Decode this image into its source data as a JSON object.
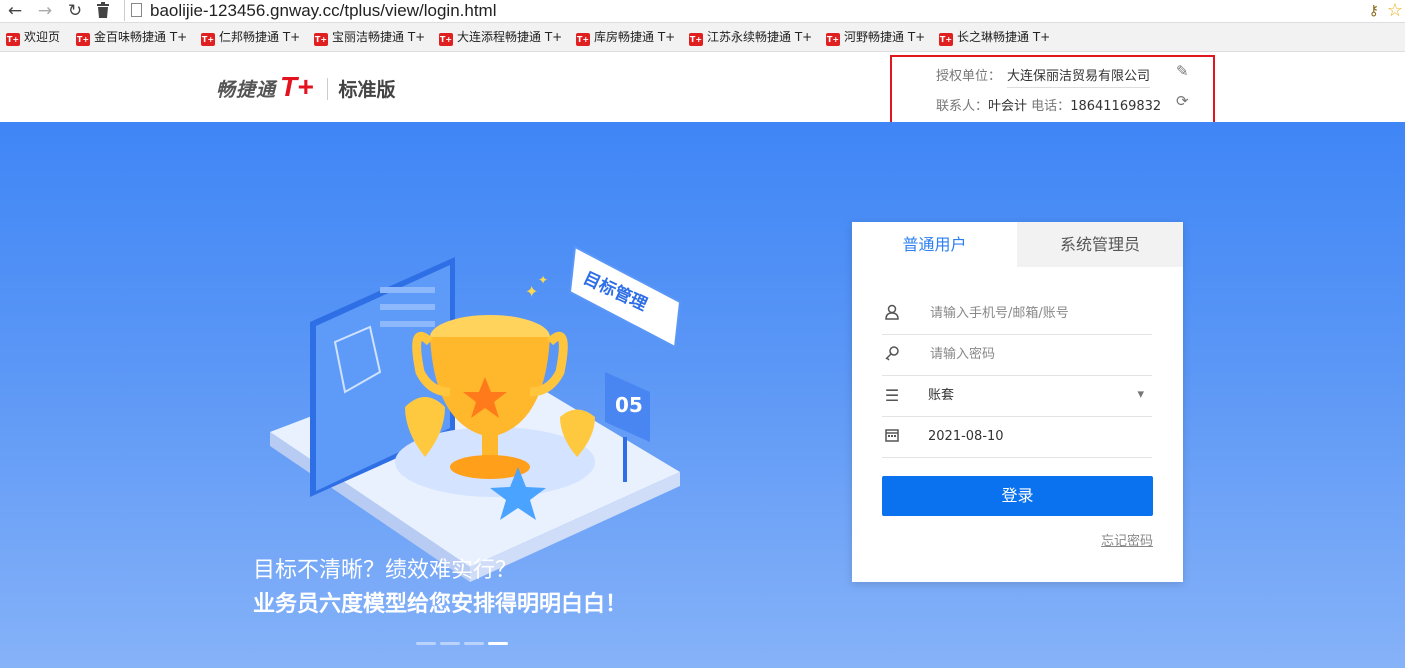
{
  "browser": {
    "back_icon": "arrow-left-icon",
    "forward_icon": "arrow-right-icon",
    "reload_icon": "reload-icon",
    "trash_icon": "trash-icon",
    "url": "baolijie-123456.gnway.cc/tplus/view/login.html",
    "key_icon": "key-icon",
    "star_icon": "star-icon"
  },
  "bookmarks": [
    {
      "label": "欢迎页"
    },
    {
      "label": "金百味畅捷通 T+"
    },
    {
      "label": "仁邦畅捷通 T+"
    },
    {
      "label": "宝丽洁畅捷通 T+"
    },
    {
      "label": "大连添程畅捷通 T+"
    },
    {
      "label": "库房畅捷通 T+"
    },
    {
      "label": "江苏永续畅捷通 T+"
    },
    {
      "label": "河野畅捷通 T+"
    },
    {
      "label": "长之琳畅捷通 T+"
    }
  ],
  "bookmark_favicon_text": "T+",
  "header": {
    "brand": "畅捷通",
    "brand_mark": "T+",
    "edition": "标准版"
  },
  "license": {
    "label": "授权单位：",
    "company": "大连保丽洁贸易有限公司",
    "contact_label": "联系人：",
    "contact_name": "叶会计",
    "phone_label": "电话：",
    "phone": "18641169832",
    "highlight_color": "#e0181e"
  },
  "banner": {
    "illustration_sign": "目标管理",
    "illustration_number": "05",
    "slogan_line1": "目标不清晰？绩效难实行？",
    "slogan_line2": "业务员六度模型给您安排得明明白白！",
    "carousel_active_index": 3,
    "carousel_count": 4
  },
  "login": {
    "tab_normal": "普通用户",
    "tab_admin": "系统管理员",
    "username_placeholder": "请输入手机号/邮箱/账号",
    "password_placeholder": "请输入密码",
    "account_set": "账套",
    "date": "2021-08-10",
    "login_button": "登录",
    "forgot_password": "忘记密码",
    "accent_color": "#0a72ee"
  }
}
